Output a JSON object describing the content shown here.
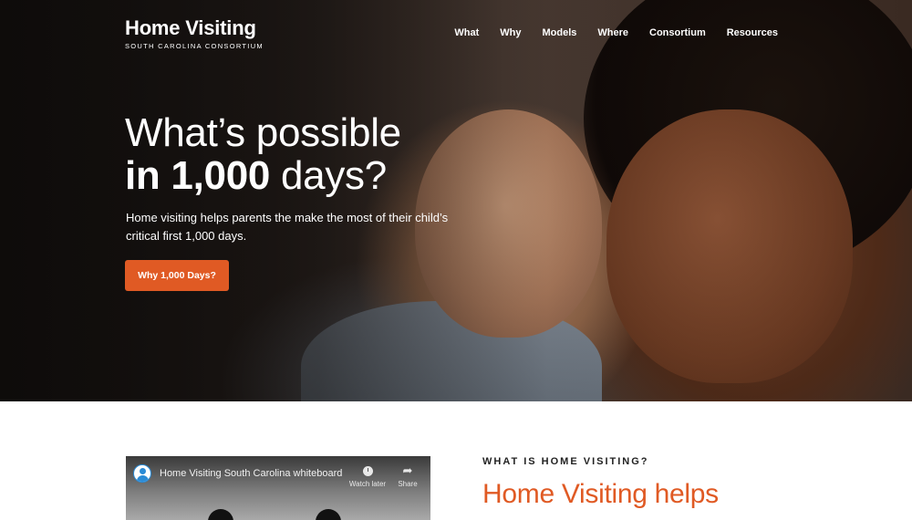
{
  "header": {
    "logo_title": "Home Visiting",
    "logo_subtitle": "SOUTH CAROLINA CONSORTIUM",
    "nav": [
      "What",
      "Why",
      "Models",
      "Where",
      "Consortium",
      "Resources"
    ]
  },
  "hero": {
    "title_line1": "What’s possible",
    "title_line2_bold": "in 1,000",
    "title_line2_rest": " days?",
    "text": "Home visiting helps parents the make the most of their child’s critical first 1,000 days.",
    "button_label": "Why 1,000 Days?"
  },
  "video": {
    "title": "Home Visiting South Carolina whiteboard",
    "watch_later": "Watch later",
    "share": "Share"
  },
  "section": {
    "kicker": "WHAT IS HOME VISITING?",
    "heading": "Home Visiting helps"
  },
  "colors": {
    "accent": "#e05a24",
    "text_dark": "#222222",
    "white": "#ffffff"
  },
  "icons": [
    "account-avatar-icon",
    "clock-icon",
    "share-arrow-icon"
  ]
}
